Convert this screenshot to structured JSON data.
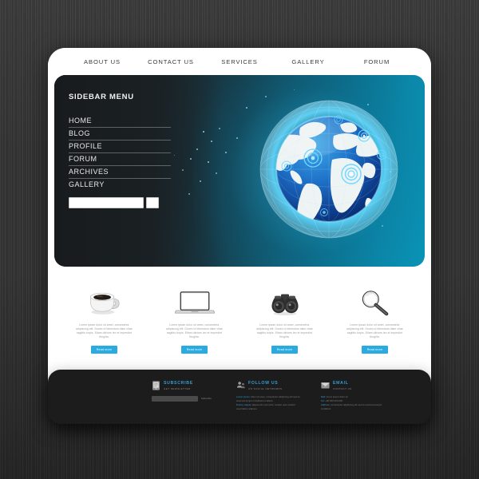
{
  "topnav": {
    "items": [
      {
        "label": "ABOUT US"
      },
      {
        "label": "CONTACT US"
      },
      {
        "label": "SERVICES"
      },
      {
        "label": "GALLERY"
      },
      {
        "label": "FORUM"
      }
    ]
  },
  "sidebar": {
    "title": "SIDEBAR MENU",
    "items": [
      {
        "label": "HOME"
      },
      {
        "label": "BLOG"
      },
      {
        "label": "PROFILE"
      },
      {
        "label": "FORUM"
      },
      {
        "label": "ARCHIVES"
      },
      {
        "label": "GALLERY"
      }
    ],
    "search": {
      "value": "",
      "placeholder": ""
    }
  },
  "hero": {
    "image_name": "digital-globe-network",
    "gradient_from": "#1c1f21",
    "gradient_to": "#0a93b6"
  },
  "features": [
    {
      "icon": "coffee-cup-icon",
      "text": "Lorem ipsum dolor sit amet, consectetur adipiscing elit. Donec ut bibendum diam vitae sagittis turpis. Etiam ultrices leo et imperdiet fringilla.",
      "button": "Read more"
    },
    {
      "icon": "laptop-icon",
      "text": "Lorem ipsum dolor sit amet, consectetur adipiscing elit. Donec ut bibendum diam vitae sagittis turpis. Etiam ultrices leo et imperdiet fringilla.",
      "button": "Read more"
    },
    {
      "icon": "binoculars-icon",
      "text": "Lorem ipsum dolor sit amet, consectetur adipiscing elit. Donec ut bibendum diam vitae sagittis turpis. Etiam ultrices leo et imperdiet fringilla.",
      "button": "Read more"
    },
    {
      "icon": "magnifier-icon",
      "text": "Lorem ipsum dolor sit amet, consectetur adipiscing elit. Donec ut bibendum diam vitae sagittis turpis. Etiam ultrices leo et imperdiet fringilla.",
      "button": "Read more"
    }
  ],
  "footer": {
    "accent": "#2f9fd4",
    "subscribe": {
      "icon": "newsletter-icon",
      "title": "SUBSCRIBE",
      "subtitle": "GET NEWSLETTER",
      "input_value": "",
      "button": "Subscribe"
    },
    "follow": {
      "icon": "users-icon",
      "title": "FOLLOW US",
      "subtitle": "ON SOCIAL NETWORKS",
      "line1_link": "Lorem ipsum:",
      "line1_rest": " dolor sit amet, consectetur adipiscing elit sed do eiusmod tempor incididunt ut labore.",
      "line2_link": "Dolore magna:",
      "line2_rest": " aliqua enim ad minim veniam quis nostrud exercitation ullamco."
    },
    "email": {
      "icon": "envelope-icon",
      "title": "EMAIL",
      "subtitle": "CONTACT US",
      "line1_link": "Mail:",
      "line1_rest": " lorem ipsum dolor sit",
      "line2_link": "Tel:",
      "line2_rest": " +00 000 000 000",
      "line3_link": "Address:",
      "line3_rest": " consectetur adipiscing elit sed do eiusmod tempor incididunt."
    }
  }
}
